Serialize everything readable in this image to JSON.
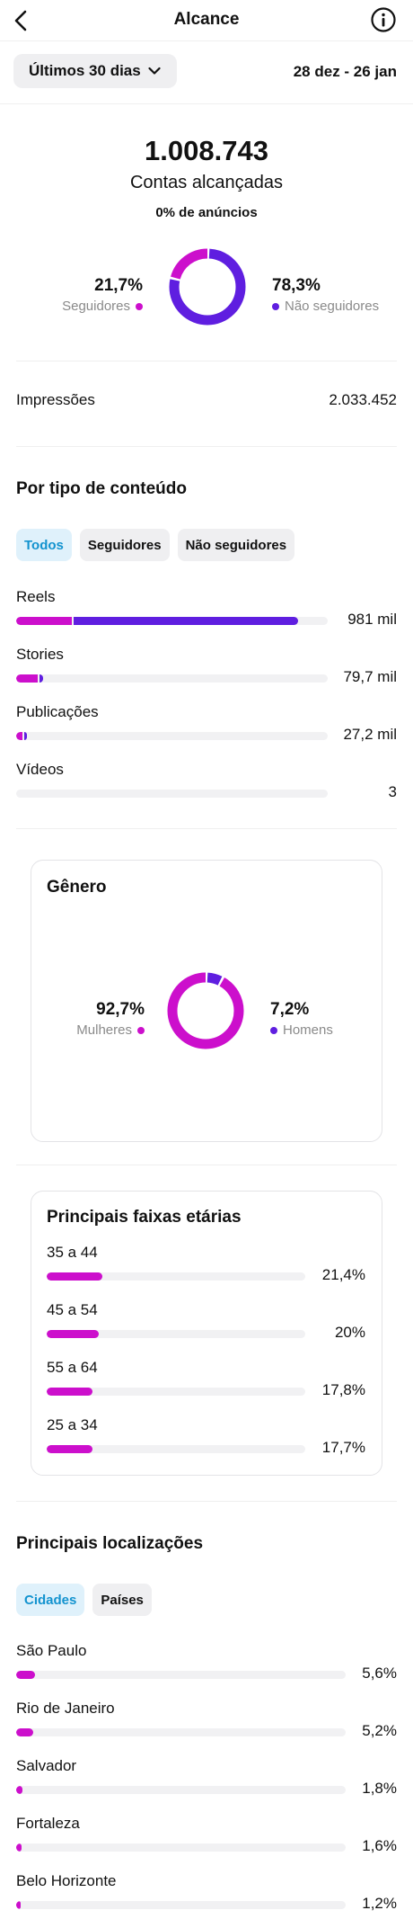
{
  "header": {
    "title": "Alcance",
    "back_icon": "chevron-left-icon",
    "info_icon": "info-icon"
  },
  "period": {
    "selector_label": "Últimos 30 dias",
    "date_range": "28 dez - 26 jan"
  },
  "summary": {
    "accounts_reached": "1.008.743",
    "accounts_reached_label": "Contas alcançadas",
    "ads_share": "0% de anúncios",
    "followers_pct_text": "21,7%",
    "followers_label": "Seguidores",
    "non_followers_pct_text": "78,3%",
    "non_followers_label": "Não seguidores",
    "followers_fraction": 0.217
  },
  "impressions": {
    "label": "Impressões",
    "value": "2.033.452"
  },
  "content_type": {
    "title": "Por tipo de conteúdo",
    "filters": [
      "Todos",
      "Seguidores",
      "Não seguidores"
    ],
    "active_filter": 0,
    "rows": [
      {
        "name": "Reels",
        "value": "981 mil",
        "followers_fraction": 0.18,
        "non_followers_fraction": 0.72
      },
      {
        "name": "Stories",
        "value": "79,7 mil",
        "followers_fraction": 0.07,
        "non_followers_fraction": 0.01
      },
      {
        "name": "Publicações",
        "value": "27,2 mil",
        "followers_fraction": 0.02,
        "non_followers_fraction": 0.01
      },
      {
        "name": "Vídeos",
        "value": "3",
        "followers_fraction": 0,
        "non_followers_fraction": 0
      }
    ]
  },
  "gender": {
    "title": "Gênero",
    "women_pct_text": "92,7%",
    "women_label": "Mulheres",
    "men_pct_text": "7,2%",
    "men_label": "Homens",
    "women_fraction": 0.927
  },
  "age": {
    "title": "Principais faixas etárias",
    "rows": [
      {
        "name": "35 a 44",
        "value": "21,4%",
        "fraction": 0.214
      },
      {
        "name": "45 a 54",
        "value": "20%",
        "fraction": 0.2
      },
      {
        "name": "55 a 64",
        "value": "17,8%",
        "fraction": 0.178
      },
      {
        "name": "25 a 34",
        "value": "17,7%",
        "fraction": 0.177
      }
    ]
  },
  "locations": {
    "title": "Principais localizações",
    "filters": [
      "Cidades",
      "Países"
    ],
    "active_filter": 0,
    "rows": [
      {
        "name": "São Paulo",
        "value": "5,6%",
        "fraction": 0.056
      },
      {
        "name": "Rio de Janeiro",
        "value": "5,2%",
        "fraction": 0.052
      },
      {
        "name": "Salvador",
        "value": "1,8%",
        "fraction": 0.018
      },
      {
        "name": "Fortaleza",
        "value": "1,6%",
        "fraction": 0.016
      },
      {
        "name": "Belo Horizonte",
        "value": "1,2%",
        "fraction": 0.012
      }
    ]
  },
  "colors": {
    "followers": "#cc0fcc",
    "non_followers": "#5f1ee0",
    "track": "#f1f1f3",
    "active_chip_bg": "#dff1fb",
    "active_chip_text": "#1393cf"
  }
}
